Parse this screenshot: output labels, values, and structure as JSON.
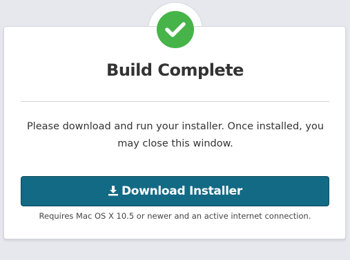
{
  "dialog": {
    "title": "Build Complete",
    "message": "Please download and run your installer. Once installed, you may close this window.",
    "download_button_label": "Download Installer",
    "requirements_text": "Requires Mac OS X 10.5 or newer and an active internet connection."
  },
  "icons": {
    "status": "check-icon",
    "download": "download-icon"
  },
  "colors": {
    "success_green": "#46b449",
    "button_blue": "#136a84",
    "page_background": "#e6e8ee"
  }
}
